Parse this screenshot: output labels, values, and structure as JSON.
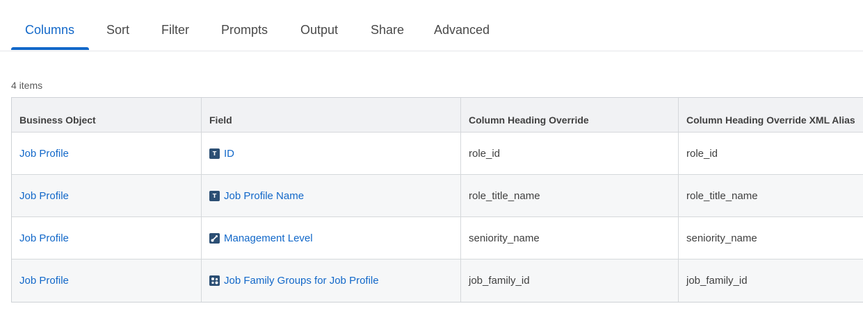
{
  "tabs": [
    {
      "label": "Columns",
      "active": true
    },
    {
      "label": "Sort"
    },
    {
      "label": "Filter"
    },
    {
      "label": "Prompts"
    },
    {
      "label": "Output"
    },
    {
      "label": "Share"
    },
    {
      "label": "Advanced"
    }
  ],
  "grid": {
    "item_count": "4 items",
    "headers": [
      "Business Object",
      "Field",
      "Column Heading Override",
      "Column Heading Override XML Alias"
    ],
    "rows": [
      {
        "business_object": "Job Profile",
        "field": "ID",
        "field_icon": "text-field-icon",
        "override": "role_id",
        "xml_alias": "role_id"
      },
      {
        "business_object": "Job Profile",
        "field": "Job Profile Name",
        "field_icon": "text-field-icon",
        "override": "role_title_name",
        "xml_alias": "role_title_name"
      },
      {
        "business_object": "Job Profile",
        "field": "Management Level",
        "field_icon": "single-instance-field-icon",
        "override": "seniority_name",
        "xml_alias": "seniority_name"
      },
      {
        "business_object": "Job Profile",
        "field": "Job Family Groups for Job Profile",
        "field_icon": "multi-instance-field-icon",
        "override": "job_family_id",
        "xml_alias": "job_family_id"
      }
    ]
  },
  "colors": {
    "accent": "#1268c9",
    "icon_bg": "#2c4f74"
  }
}
